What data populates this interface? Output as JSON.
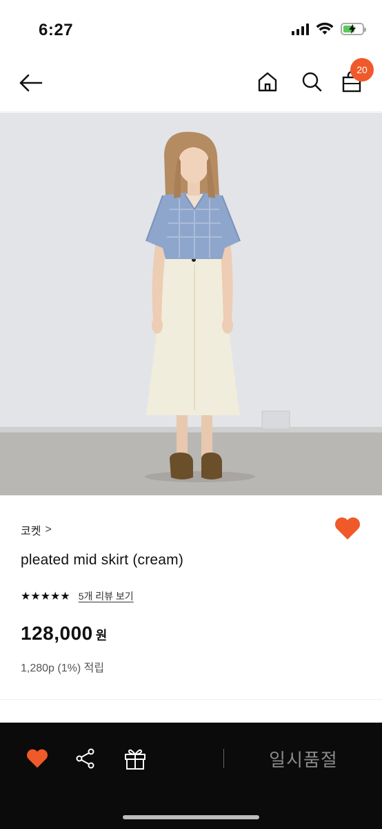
{
  "status_bar": {
    "time": "6:27"
  },
  "header": {
    "back_icon": "arrow-left-icon",
    "home_icon": "home-icon",
    "search_icon": "search-icon",
    "bag_icon": "shopping-bag-icon",
    "bag_badge_count": "20"
  },
  "product": {
    "image_alt": "model wearing blue plaid shirt and cream pleated mid skirt",
    "brand": "코켓",
    "brand_chevron": ">",
    "name": "pleated mid skirt (cream)",
    "stars": "★★★★★",
    "rating_value": 5,
    "review_link": "5개 리뷰 보기",
    "price": "128,000",
    "price_unit": "원",
    "points": "1,280p (1%) 적립"
  },
  "bottom_bar": {
    "heart_icon": "heart-icon",
    "share_icon": "share-icon",
    "gift_icon": "gift-icon",
    "soldout_label": "일시품절"
  },
  "colors": {
    "accent": "#f0592a",
    "bottom_bar_bg": "#0b0b0b",
    "soldout_text": "#8a8a8a"
  }
}
